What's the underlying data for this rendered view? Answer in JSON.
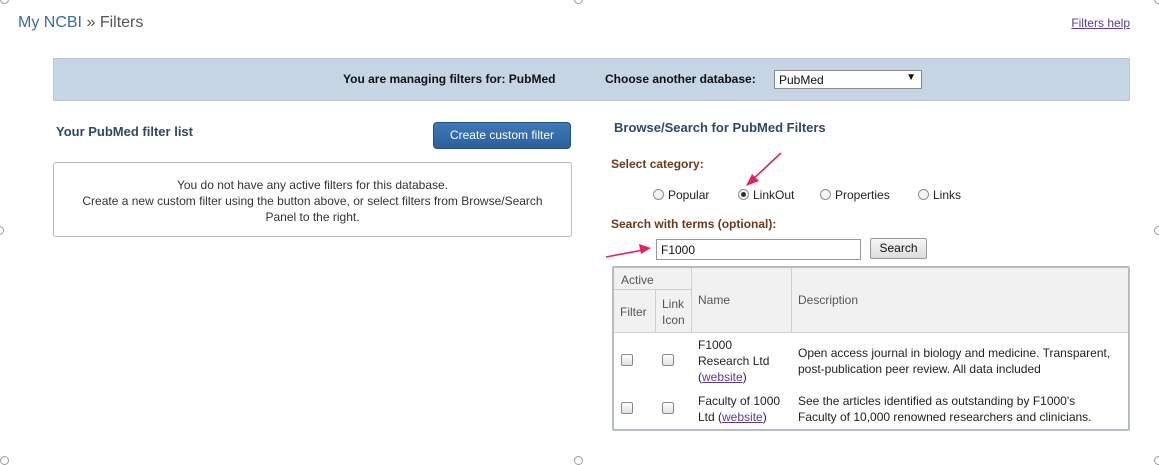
{
  "breadcrumb": {
    "home": "My NCBI",
    "separator": "»",
    "current": "Filters"
  },
  "help_link": "Filters help",
  "db_bar": {
    "managing_text": "You are managing filters for: PubMed",
    "choose_label": "Choose another database:",
    "selected_db": "PubMed",
    "dropdown_arrow": "▼"
  },
  "left_panel": {
    "title": "Your PubMed filter list",
    "create_button": "Create custom filter",
    "empty_lines": [
      "You do not have any active filters for this database.",
      "Create a new custom filter using the button above, or select filters from Browse/Search",
      "Panel to the right."
    ]
  },
  "right_panel": {
    "title": "Browse/Search for PubMed Filters",
    "category_label": "Select category:",
    "categories": [
      {
        "label": "Popular",
        "selected": false
      },
      {
        "label": "LinkOut",
        "selected": true
      },
      {
        "label": "Properties",
        "selected": false
      },
      {
        "label": "Links",
        "selected": false
      }
    ],
    "terms_label": "Search with terms (optional):",
    "search_value": "F1000",
    "search_button": "Search"
  },
  "results_table": {
    "headers": {
      "active": "Active",
      "filter": "Filter",
      "link_icon_1": "Link",
      "link_icon_2": "Icon",
      "name": "Name",
      "description": "Description"
    },
    "rows": [
      {
        "name_lines": [
          "F1000",
          "Research Ltd"
        ],
        "name_link_prefix": "(",
        "name_link": "website",
        "name_link_suffix": ")",
        "description_lines": [
          "Open access journal in biology and medicine. Transparent,",
          "post-publication peer review. All data included"
        ]
      },
      {
        "name_lines": [
          "Faculty of 1000"
        ],
        "name_link_prefix": "Ltd (",
        "name_link": "website",
        "name_link_suffix": ")",
        "description_lines": [
          "See the articles identified as outstanding by F1000's",
          "Faculty of 10,000 renowned researchers and clinicians."
        ]
      }
    ]
  },
  "colors": {
    "accent_arrow": "#e0245e",
    "db_bar_bg": "#c5d5e3",
    "button_blue": "#2c5f9b",
    "section_title": "#2e4963",
    "field_label": "#6a3a1c"
  }
}
